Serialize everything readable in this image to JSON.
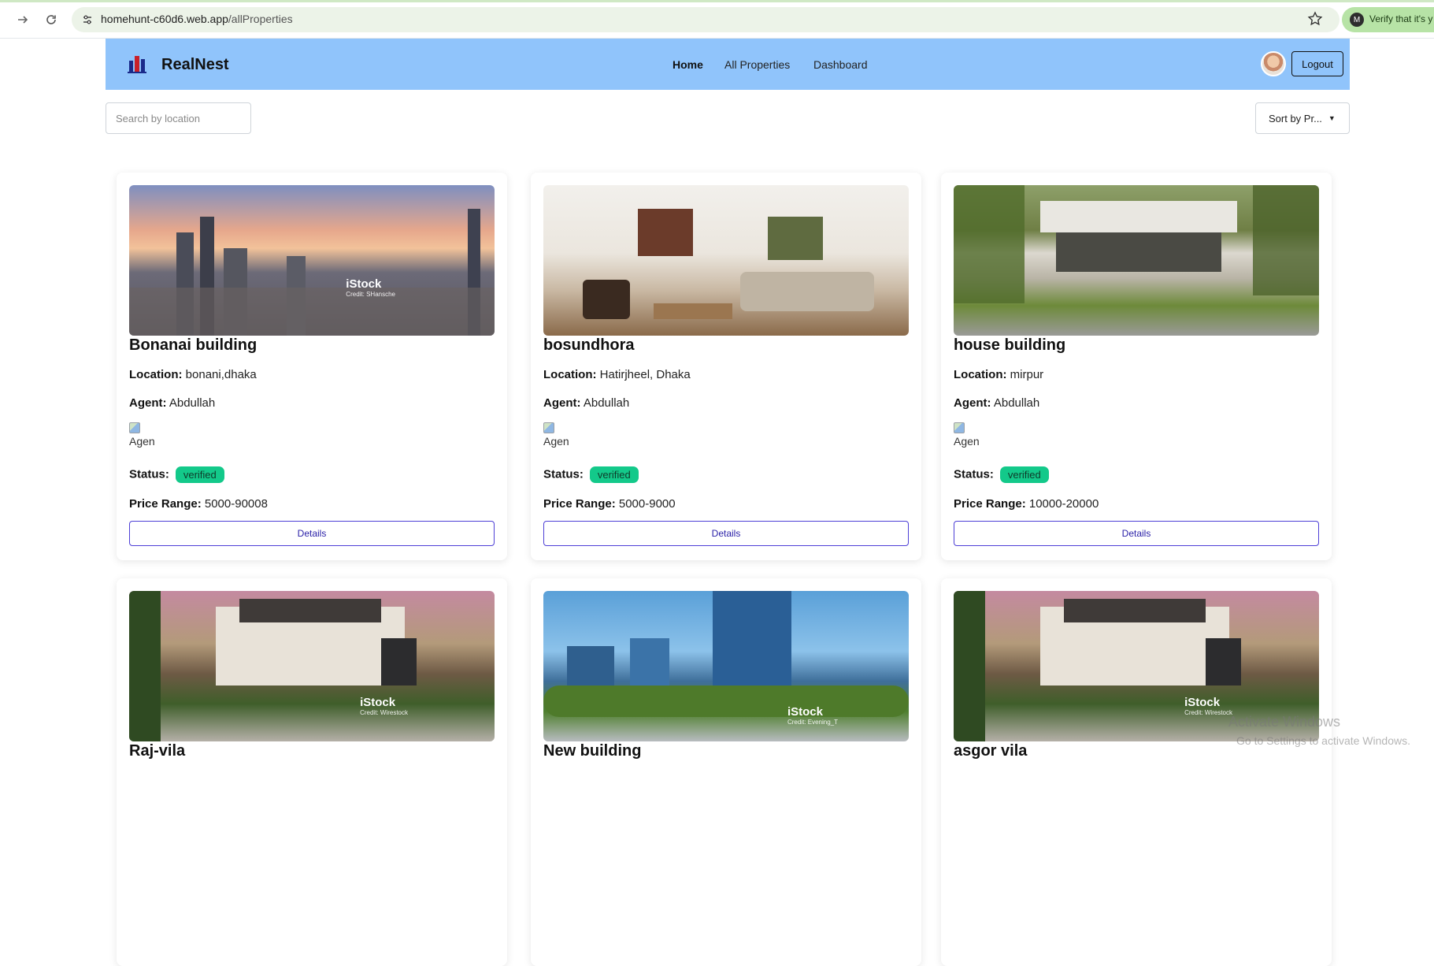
{
  "browser": {
    "url_host": "homehunt-c60d6.web.app",
    "url_path": "/allProperties",
    "verify_text": "Verify that it's y",
    "profile_initial": "M"
  },
  "navbar": {
    "brand": "RealNest",
    "menu": [
      "Home",
      "All Properties",
      "Dashboard"
    ],
    "logout": "Logout"
  },
  "controls": {
    "search_placeholder": "Search by location",
    "sort_label": "Sort by Pr..."
  },
  "labels": {
    "location": "Location:",
    "agent": "Agent:",
    "status": "Status:",
    "price_range": "Price Range:",
    "agent_img_alt": "Agen",
    "details": "Details"
  },
  "properties": [
    {
      "title": "Bonanai building",
      "location": "bonani,dhaka",
      "agent": "Abdullah",
      "status": "verified",
      "price": "5000-90008",
      "credit": "Credit: SHansche"
    },
    {
      "title": "bosundhora",
      "location": "Hatirjheel, Dhaka",
      "agent": "Abdullah",
      "status": "verified",
      "price": "5000-9000",
      "credit": ""
    },
    {
      "title": "house building",
      "location": "mirpur",
      "agent": "Abdullah",
      "status": "verified",
      "price": "10000-20000",
      "credit": ""
    },
    {
      "title": "Raj-vila",
      "credit": "Credit: Wirestock"
    },
    {
      "title": "New building",
      "credit": "Credit: Evening_T"
    },
    {
      "title": "asgor vila",
      "credit": "Credit: Wirestock"
    }
  ],
  "watermark": "iStock",
  "windows": {
    "activate_title": "Activate Windows",
    "activate_sub": "Go to Settings to activate Windows."
  }
}
